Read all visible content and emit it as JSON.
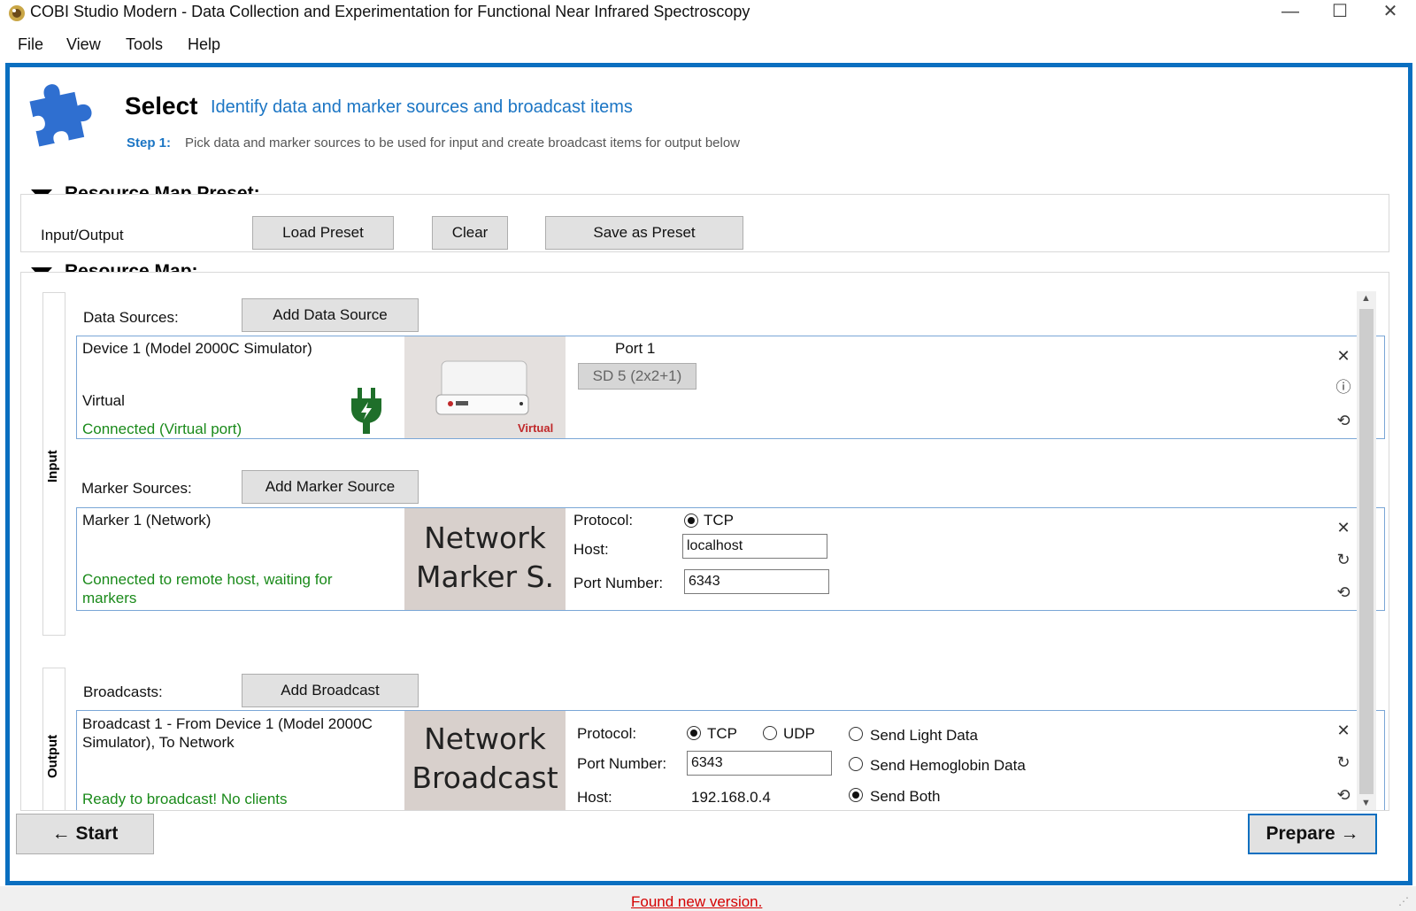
{
  "window": {
    "title": "COBI Studio Modern - Data Collection and Experimentation for Functional Near Infrared Spectroscopy",
    "controls": {
      "minimize": "—",
      "maximize": "☐",
      "close": "✕"
    }
  },
  "menu": {
    "items": [
      "File",
      "View",
      "Tools",
      "Help"
    ]
  },
  "header": {
    "title": "Select",
    "subtitle": "Identify data and marker sources and broadcast items",
    "step_label": "Step 1:",
    "step_text": "Pick data and marker sources to be used for input and create broadcast items for output below",
    "icon": "puzzle-icon"
  },
  "preset": {
    "section_title": "Resource Map Preset:",
    "row_label": "Input/Output",
    "load_label": "Load Preset",
    "clear_label": "Clear",
    "save_label": "Save as Preset"
  },
  "resource_map": {
    "section_title": "Resource Map:",
    "input_tab": "Input",
    "output_tab": "Output",
    "data_sources_label": "Data Sources:",
    "add_data_source_label": "Add Data Source",
    "marker_sources_label": "Marker Sources:",
    "add_marker_source_label": "Add Marker Source",
    "broadcasts_label": "Broadcasts:",
    "add_broadcast_label": "Add Broadcast"
  },
  "device": {
    "name": "Device 1 (Model 2000C Simulator)",
    "type": "Virtual",
    "status": "Connected (Virtual port)",
    "image_tag": "Virtual",
    "port_label": "Port 1",
    "port_button": "SD 5 (2x2+1)"
  },
  "marker": {
    "name": "Marker 1 (Network)",
    "status": "Connected to remote host, waiting for markers",
    "image_line1": "Network",
    "image_line2": "Marker S.",
    "protocol_label": "Protocol:",
    "protocol_value": "TCP",
    "host_label": "Host:",
    "host_value": "localhost",
    "port_label": "Port Number:",
    "port_value": "6343"
  },
  "broadcast": {
    "name": "Broadcast 1 - From Device 1 (Model 2000C Simulator), To Network",
    "status": "Ready to broadcast! No clients",
    "image_line1": "Network",
    "image_line2": "Broadcast",
    "protocol_label": "Protocol:",
    "protocol_tcp": "TCP",
    "protocol_udp": "UDP",
    "protocol_selected": "TCP",
    "port_label": "Port Number:",
    "port_value": "6343",
    "host_label": "Host:",
    "host_value": "192.168.0.4",
    "option_light": "Send Light Data",
    "option_hemoglobin": "Send Hemoglobin Data",
    "option_both": "Send Both",
    "option_selected": "Send Both"
  },
  "nav": {
    "back_label": "← Start",
    "next_label": "Prepare →"
  },
  "status": {
    "update_text": "Found new version."
  },
  "colors": {
    "accent": "#0a6fc0",
    "status_green": "#1a8a1a",
    "link_red": "#d40000",
    "icon_blue": "#2f6fd0"
  }
}
